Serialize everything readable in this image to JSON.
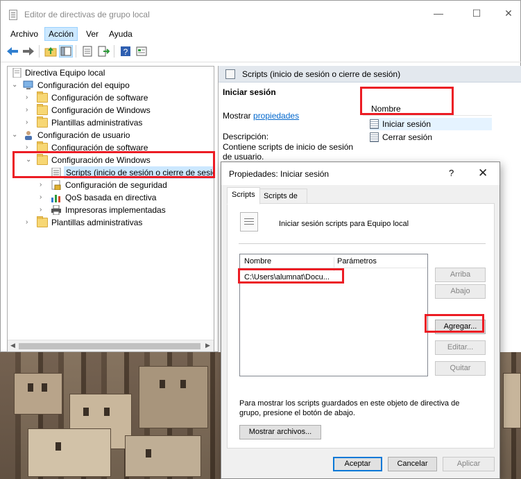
{
  "window": {
    "title": "Editor de directivas de grupo local",
    "minimize": "—",
    "maximize": "☐",
    "close": "✕"
  },
  "menu": {
    "items": [
      "Archivo",
      "Acción",
      "Ver",
      "Ayuda"
    ],
    "active": "Acción"
  },
  "toolbar": {
    "icons": [
      "back-arrow-icon",
      "forward-arrow-icon",
      "up-folder-icon",
      "show-hide-tree-icon",
      "properties-icon",
      "export-list-icon",
      "help-icon",
      "view-icon"
    ]
  },
  "tree": {
    "root": "Directiva Equipo local",
    "items": [
      {
        "label": "Configuración del equipo",
        "expanded": true
      },
      {
        "label": "Configuración de software"
      },
      {
        "label": "Configuración de Windows"
      },
      {
        "label": "Plantillas administrativas"
      },
      {
        "label": "Configuración de usuario",
        "expanded": true
      },
      {
        "label": "Configuración de software"
      },
      {
        "label": "Configuración de Windows",
        "expanded": true
      },
      {
        "label": "Scripts (inicio de sesión o cierre de sesión)",
        "selected": true
      },
      {
        "label": "Configuración de seguridad"
      },
      {
        "label": "QoS basada en directiva"
      },
      {
        "label": "Impresoras implementadas"
      },
      {
        "label": "Plantillas administrativas"
      }
    ]
  },
  "detail": {
    "header": "Scripts (inicio de sesión o cierre de sesión)",
    "section_title": "Iniciar sesión",
    "show_prefix": "Mostrar",
    "show_link": "propiedades",
    "desc_label": "Descripción:",
    "desc_text": "Contiene scripts de inicio de sesión de usuario.",
    "column_name": "Nombre",
    "items": [
      "Iniciar sesión",
      "Cerrar sesión"
    ]
  },
  "dialog": {
    "title": "Propiedades: Iniciar sesión",
    "help": "?",
    "close": "✕",
    "tabs": [
      "Scripts",
      "Scripts de PowerShell"
    ],
    "active_tab": "Scripts",
    "heading": "Iniciar sesión scripts para Equipo local",
    "list_columns": [
      "Nombre",
      "Parámetros"
    ],
    "list_rows": [
      {
        "name": "C:\\Users\\alumnat\\Docu...",
        "params": ""
      }
    ],
    "buttons": {
      "up": "Arriba",
      "down": "Abajo",
      "add": "Agregar...",
      "edit": "Editar...",
      "remove": "Quitar",
      "show_files": "Mostrar archivos..."
    },
    "info": "Para mostrar los scripts guardados en este objeto de directiva de grupo, presione el botón de abajo.",
    "footer": {
      "ok": "Aceptar",
      "cancel": "Cancelar",
      "apply": "Aplicar"
    }
  },
  "colors": {
    "annotation_red": "#ec1c24",
    "selection_blue": "#cce8ff",
    "link_blue": "#0066cc",
    "default_button_border": "#0078d7"
  }
}
